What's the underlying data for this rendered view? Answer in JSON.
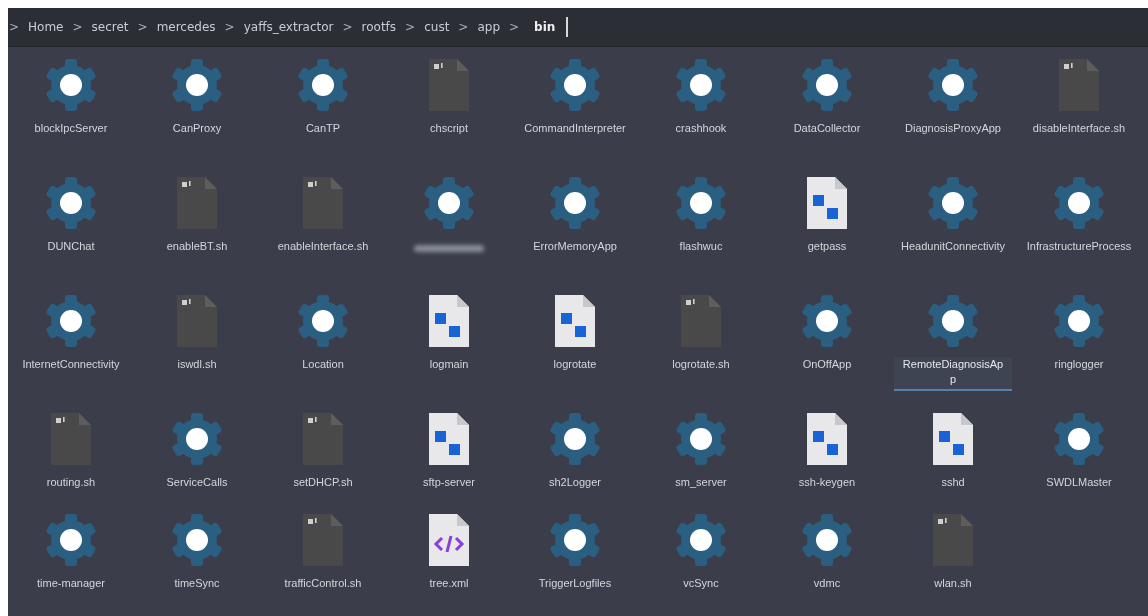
{
  "breadcrumb": {
    "separator": ">",
    "items": [
      {
        "label": "Home",
        "current": false
      },
      {
        "label": "secret",
        "current": false
      },
      {
        "label": "mercedes",
        "current": false
      },
      {
        "label": "yaffs_extractor",
        "current": false
      },
      {
        "label": "rootfs",
        "current": false
      },
      {
        "label": "cust",
        "current": false
      },
      {
        "label": "app",
        "current": false
      },
      {
        "label": "bin",
        "current": true
      }
    ]
  },
  "files": [
    {
      "name": "blockIpcServer",
      "kind": "executable",
      "selected": false
    },
    {
      "name": "CanProxy",
      "kind": "executable",
      "selected": false
    },
    {
      "name": "CanTP",
      "kind": "executable",
      "selected": false
    },
    {
      "name": "chscript",
      "kind": "script",
      "selected": false
    },
    {
      "name": "CommandInterpreter",
      "kind": "executable",
      "selected": false
    },
    {
      "name": "crashhook",
      "kind": "executable",
      "selected": false
    },
    {
      "name": "DataCollector",
      "kind": "executable",
      "selected": false
    },
    {
      "name": "DiagnosisProxyApp",
      "kind": "executable",
      "selected": false
    },
    {
      "name": "disableInterface.sh",
      "kind": "script",
      "selected": false
    },
    {
      "name": "DUNChat",
      "kind": "executable",
      "selected": false
    },
    {
      "name": "enableBT.sh",
      "kind": "script",
      "selected": false
    },
    {
      "name": "enableInterface.sh",
      "kind": "script",
      "selected": false
    },
    {
      "kind": "executable",
      "redacted": true
    },
    {
      "name": "ErrorMemoryApp",
      "kind": "executable",
      "selected": false
    },
    {
      "name": "flashwuc",
      "kind": "executable",
      "selected": false
    },
    {
      "name": "getpass",
      "kind": "binary",
      "selected": false
    },
    {
      "name": "HeadunitConnectivity",
      "kind": "executable",
      "selected": false
    },
    {
      "name": "InfrastructureProcess",
      "kind": "executable",
      "selected": false
    },
    {
      "name": "InternetConnectivity",
      "kind": "executable",
      "selected": false
    },
    {
      "name": "iswdl.sh",
      "kind": "script",
      "selected": false
    },
    {
      "name": "Location",
      "kind": "executable",
      "selected": false
    },
    {
      "name": "logmain",
      "kind": "binary",
      "selected": false
    },
    {
      "name": "logrotate",
      "kind": "binary",
      "selected": false
    },
    {
      "name": "logrotate.sh",
      "kind": "script",
      "selected": false
    },
    {
      "name": "OnOffApp",
      "kind": "executable",
      "selected": false
    },
    {
      "name": "RemoteDiagnosisApp",
      "kind": "executable",
      "selected": true
    },
    {
      "name": "ringlogger",
      "kind": "executable",
      "selected": false
    },
    {
      "name": "routing.sh",
      "kind": "script",
      "selected": false
    },
    {
      "name": "ServiceCalls",
      "kind": "executable",
      "selected": false
    },
    {
      "name": "setDHCP.sh",
      "kind": "script",
      "selected": false
    },
    {
      "name": "sftp-server",
      "kind": "binary",
      "selected": false
    },
    {
      "name": "sh2Logger",
      "kind": "executable",
      "selected": false
    },
    {
      "name": "sm_server",
      "kind": "executable",
      "selected": false
    },
    {
      "name": "ssh-keygen",
      "kind": "binary",
      "selected": false
    },
    {
      "name": "sshd",
      "kind": "binary",
      "selected": false
    },
    {
      "name": "SWDLMaster",
      "kind": "executable",
      "selected": false
    },
    {
      "name": "time-manager",
      "kind": "executable",
      "selected": false
    },
    {
      "name": "timeSync",
      "kind": "executable",
      "selected": false
    },
    {
      "name": "trafficControl.sh",
      "kind": "script",
      "selected": false
    },
    {
      "name": "tree.xml",
      "kind": "xml",
      "selected": false
    },
    {
      "name": "TriggerLogfiles",
      "kind": "executable",
      "selected": false
    },
    {
      "name": "vcSync",
      "kind": "executable",
      "selected": false
    },
    {
      "name": "vdmc",
      "kind": "executable",
      "selected": false
    },
    {
      "name": "wlan.sh",
      "kind": "script",
      "selected": false
    }
  ]
}
